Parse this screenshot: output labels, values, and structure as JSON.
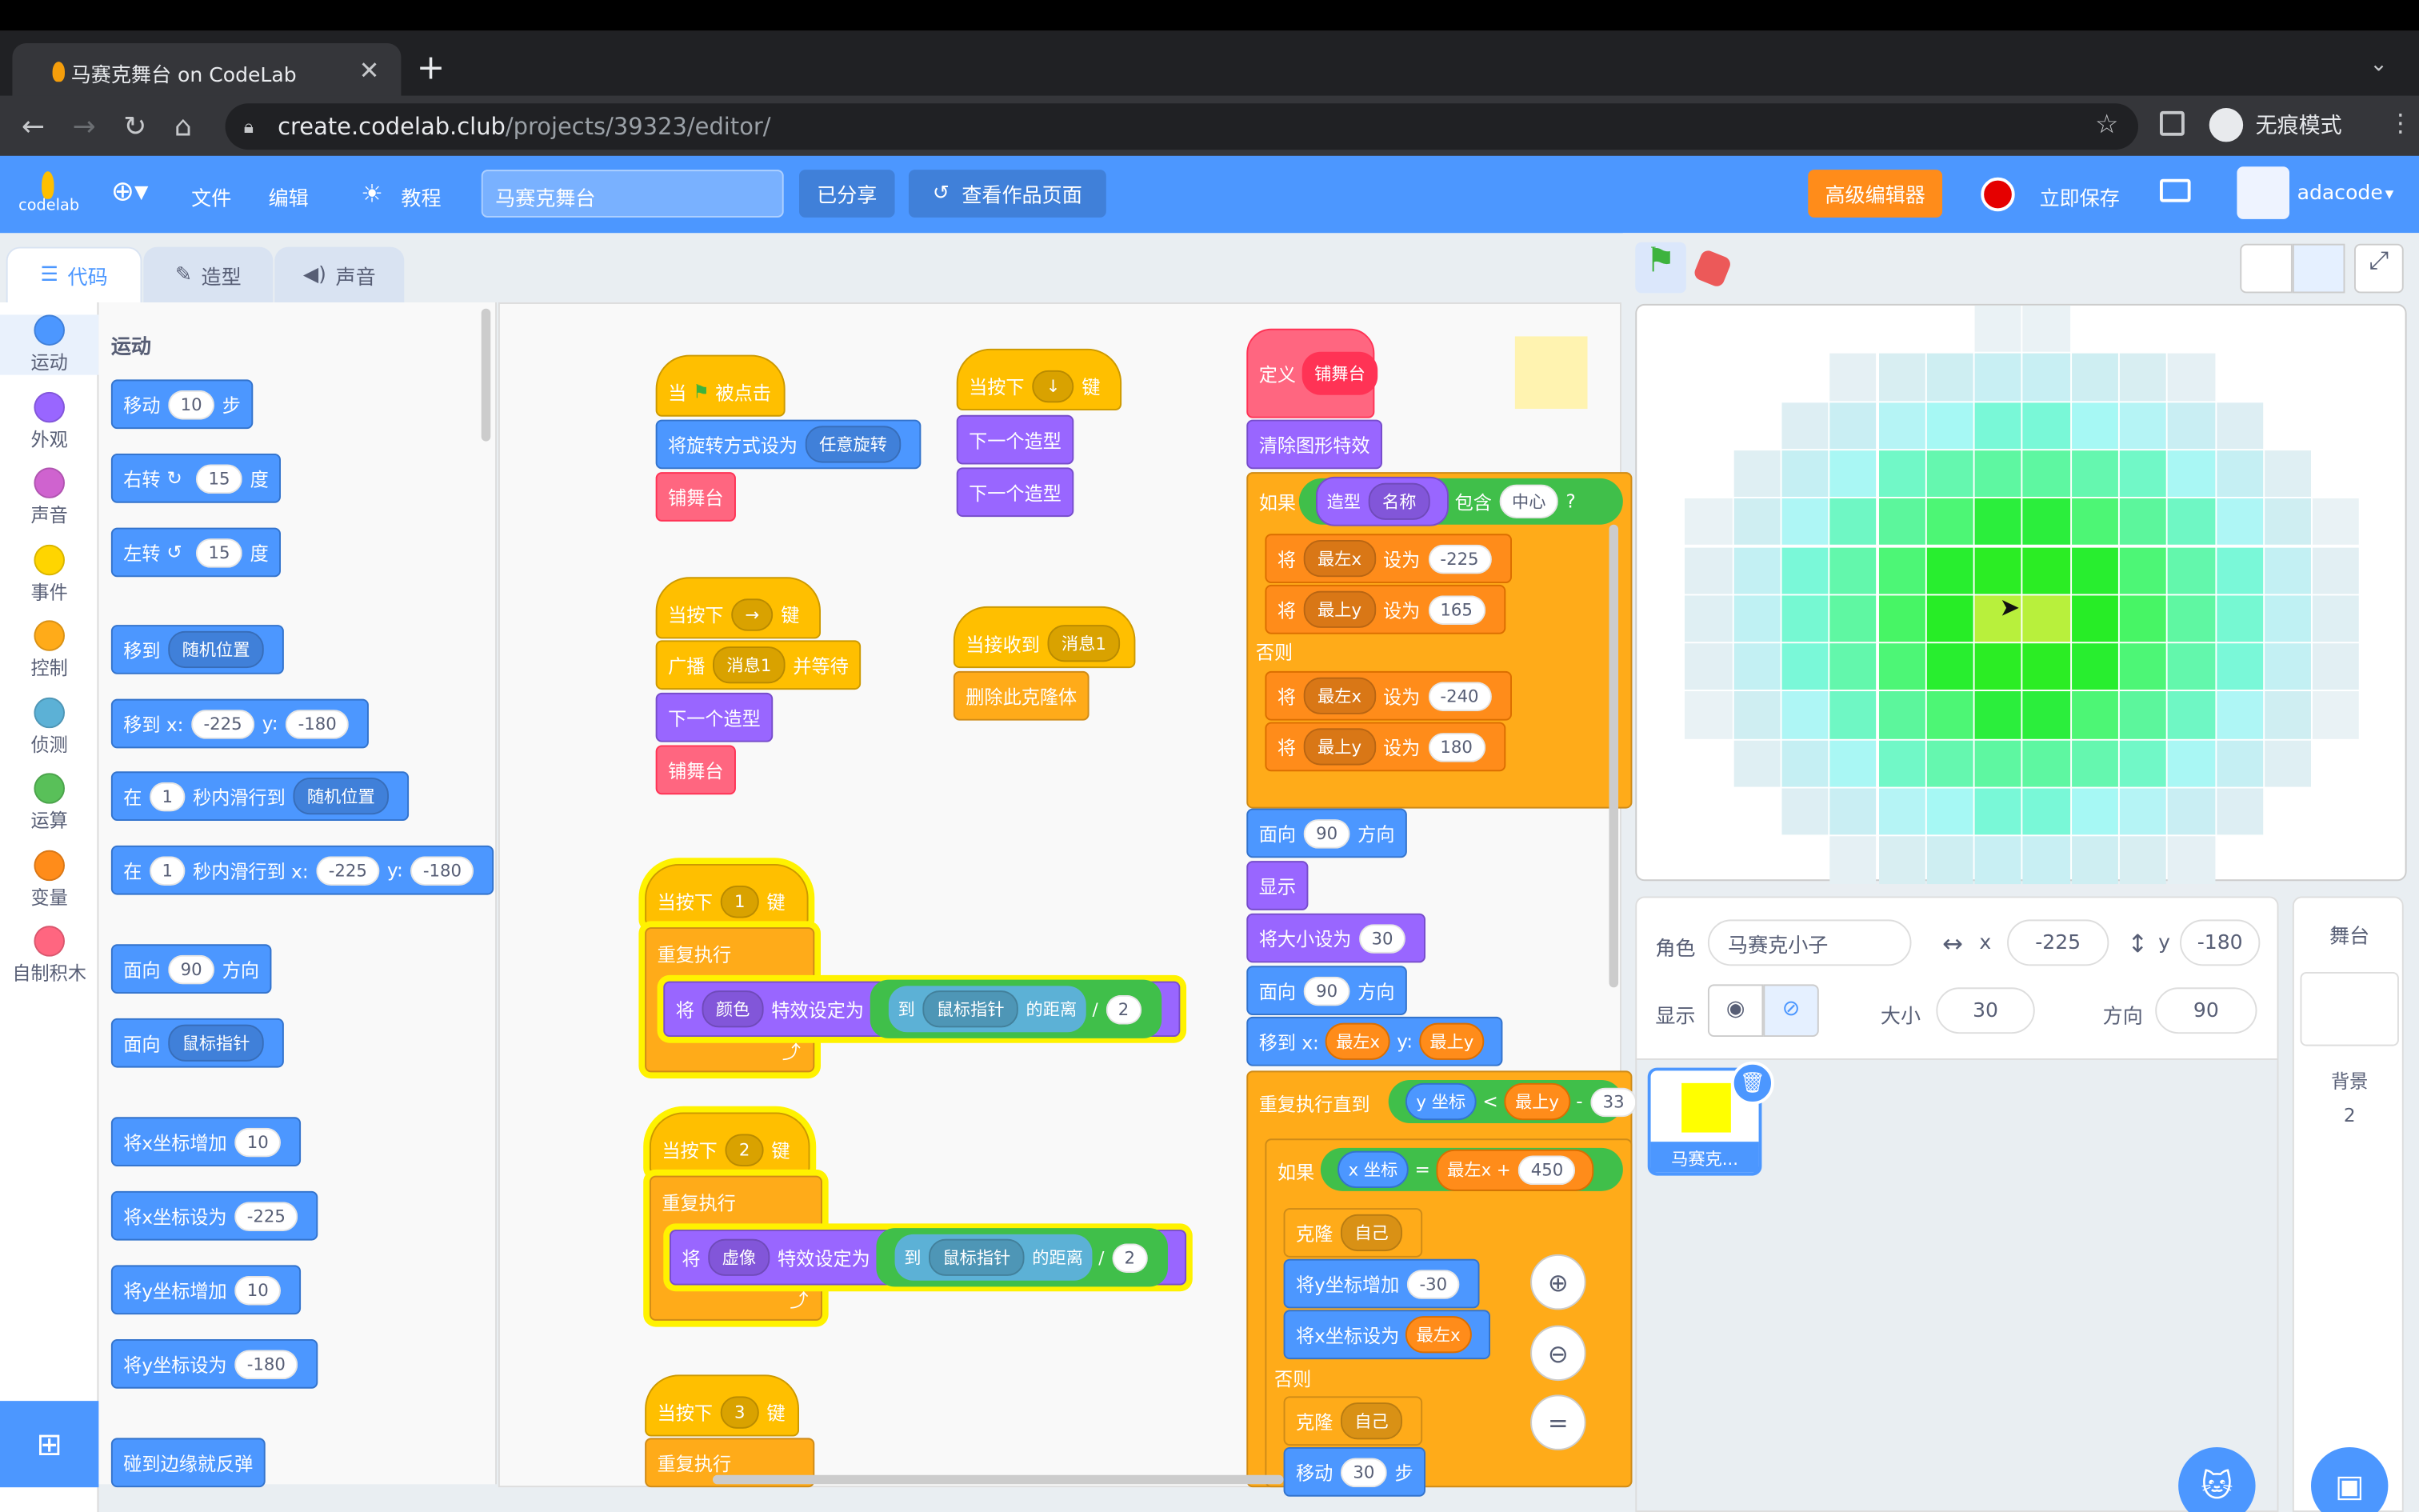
{
  "browser": {
    "tab_title": "马赛克舞台 on CodeLab",
    "url_host": "create.codelab.club",
    "url_path": "/projects/39323/editor/",
    "incognito_label": "无痕模式"
  },
  "menubar": {
    "file": "文件",
    "edit": "编辑",
    "tutorial": "教程",
    "project_title": "马赛克舞台",
    "shared": "已分享",
    "view_page": "查看作品页面",
    "advanced": "高级编辑器",
    "save_now": "立即保存",
    "username": "adacode"
  },
  "editor_tabs": {
    "code": "代码",
    "costumes": "造型",
    "sounds": "声音"
  },
  "categories": [
    {
      "label": "运动",
      "color": "#4c97ff"
    },
    {
      "label": "外观",
      "color": "#9966ff"
    },
    {
      "label": "声音",
      "color": "#cf63cf"
    },
    {
      "label": "事件",
      "color": "#ffd500"
    },
    {
      "label": "控制",
      "color": "#ffab19"
    },
    {
      "label": "侦测",
      "color": "#5cb1d6"
    },
    {
      "label": "运算",
      "color": "#59c059"
    },
    {
      "label": "变量",
      "color": "#ff8c1a"
    },
    {
      "label": "自制积木",
      "color": "#ff6680"
    }
  ],
  "palette": {
    "heading": "运动",
    "move": "移动",
    "move_steps": "10",
    "steps": "步",
    "turn_right": "右转",
    "turn_right_deg": "15",
    "degrees": "度",
    "turn_left": "左转",
    "turn_left_deg": "15",
    "goto": "移到",
    "random_pos": "随机位置",
    "goto_xy": "移到 x:",
    "gx": "-225",
    "y": "y:",
    "gy": "-180",
    "glide_in": "在",
    "glide_secs": "1",
    "glide_to": "秒内滑行到",
    "glide_to_xy": "秒内滑行到 x:",
    "glide_x": "-225",
    "glide_y": "-180",
    "point_dir": "面向",
    "point_dir_val": "90",
    "direction": "方向",
    "point_towards": "面向",
    "mouse_pointer": "鼠标指针",
    "change_x": "将x坐标增加",
    "change_x_val": "10",
    "set_x": "将x坐标设为",
    "set_x_val": "-225",
    "change_y": "将y坐标增加",
    "change_y_val": "10",
    "set_y": "将y坐标设为",
    "set_y_val": "-180",
    "bounce": "碰到边缘就反弹"
  },
  "scripts": {
    "flag_when": "当",
    "flag_clicked": "被点击",
    "set_rotation": "将旋转方式设为",
    "any_rotation": "任意旋转",
    "tile_stage": "铺舞台",
    "when_key": "当按下",
    "key_word": "键",
    "down_arrow": "↓",
    "right_arrow": "→",
    "next_costume": "下一个造型",
    "broadcast": "广播",
    "msg1": "消息1",
    "and_wait": "并等待",
    "when_receive": "当接收到",
    "delete_clone": "删除此克隆体",
    "key1": "1",
    "key2": "2",
    "key3": "3",
    "forever": "重复执行",
    "set_to": "将",
    "color_fx": "颜色",
    "ghost_fx": "虚像",
    "fx_set": "特效设定为",
    "to": "到",
    "mouse_pointer": "鼠标指针",
    "distance": "的距离",
    "div": "/",
    "two": "2",
    "define": "定义",
    "define_name": "铺舞台",
    "clear_fx": "清除图形特效",
    "if": "如果",
    "costume": "造型",
    "name": "名称",
    "contains": "包含",
    "center": "中心",
    "q": "?",
    "set_word": "设为",
    "leftx": "最左x",
    "topy": "最上y",
    "v_n225": "-225",
    "v_165": "165",
    "v_n240": "-240",
    "v_180": "180",
    "else": "否则",
    "face": "面向",
    "face_val": "90",
    "dir": "方向",
    "show": "显示",
    "set_size": "将大小设为",
    "size_val": "30",
    "goto_x": "移到 x:",
    "goto_y": "y:",
    "repeat_until": "重复执行直到",
    "y_pos": "y 坐标",
    "lt": "<",
    "minus": "-",
    "v_33": "33",
    "x_pos": "x 坐标",
    "eq": "=",
    "plus": "+",
    "v_450": "450",
    "clone": "克隆",
    "myself": "自己",
    "change_y_by": "将y坐标增加",
    "v_n30": "-30",
    "set_x_to": "将x坐标设为",
    "move": "移动",
    "move_val": "30",
    "steps": "步"
  },
  "sprite_info": {
    "sprite_label": "角色",
    "sprite_name": "马赛克小子",
    "x_label": "x",
    "x": "-225",
    "y_label": "y",
    "y": "-180",
    "show_label": "显示",
    "size_label": "大小",
    "size": "30",
    "dir_label": "方向",
    "dir": "90",
    "thumb_name": "马赛克..."
  },
  "stage_panel": {
    "title": "舞台",
    "backdrops_label": "背景",
    "backdrops_count": "2"
  }
}
